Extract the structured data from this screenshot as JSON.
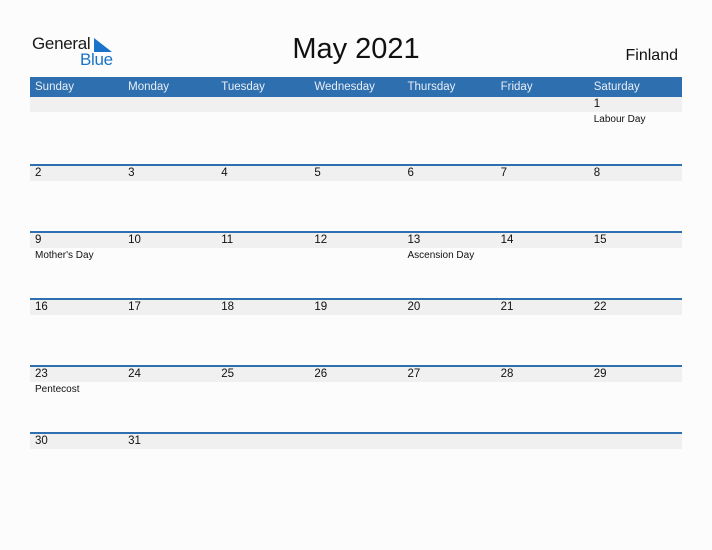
{
  "brand": {
    "general": "General",
    "blue": "Blue"
  },
  "title": "May 2021",
  "country": "Finland",
  "colors": {
    "header": "#2e6fb0",
    "band": "#f0f0f0",
    "brand_blue": "#1a73c8"
  },
  "weekdays": [
    "Sunday",
    "Monday",
    "Tuesday",
    "Wednesday",
    "Thursday",
    "Friday",
    "Saturday"
  ],
  "weeks": [
    [
      {
        "d": ""
      },
      {
        "d": ""
      },
      {
        "d": ""
      },
      {
        "d": ""
      },
      {
        "d": ""
      },
      {
        "d": ""
      },
      {
        "d": "1",
        "h": "Labour Day"
      }
    ],
    [
      {
        "d": "2"
      },
      {
        "d": "3"
      },
      {
        "d": "4"
      },
      {
        "d": "5"
      },
      {
        "d": "6"
      },
      {
        "d": "7"
      },
      {
        "d": "8"
      }
    ],
    [
      {
        "d": "9",
        "h": "Mother's Day"
      },
      {
        "d": "10"
      },
      {
        "d": "11"
      },
      {
        "d": "12"
      },
      {
        "d": "13",
        "h": "Ascension Day"
      },
      {
        "d": "14"
      },
      {
        "d": "15"
      }
    ],
    [
      {
        "d": "16"
      },
      {
        "d": "17"
      },
      {
        "d": "18"
      },
      {
        "d": "19"
      },
      {
        "d": "20"
      },
      {
        "d": "21"
      },
      {
        "d": "22"
      }
    ],
    [
      {
        "d": "23",
        "h": "Pentecost"
      },
      {
        "d": "24"
      },
      {
        "d": "25"
      },
      {
        "d": "26"
      },
      {
        "d": "27"
      },
      {
        "d": "28"
      },
      {
        "d": "29"
      }
    ],
    [
      {
        "d": "30"
      },
      {
        "d": "31"
      },
      {
        "d": ""
      },
      {
        "d": ""
      },
      {
        "d": ""
      },
      {
        "d": ""
      },
      {
        "d": ""
      }
    ]
  ]
}
